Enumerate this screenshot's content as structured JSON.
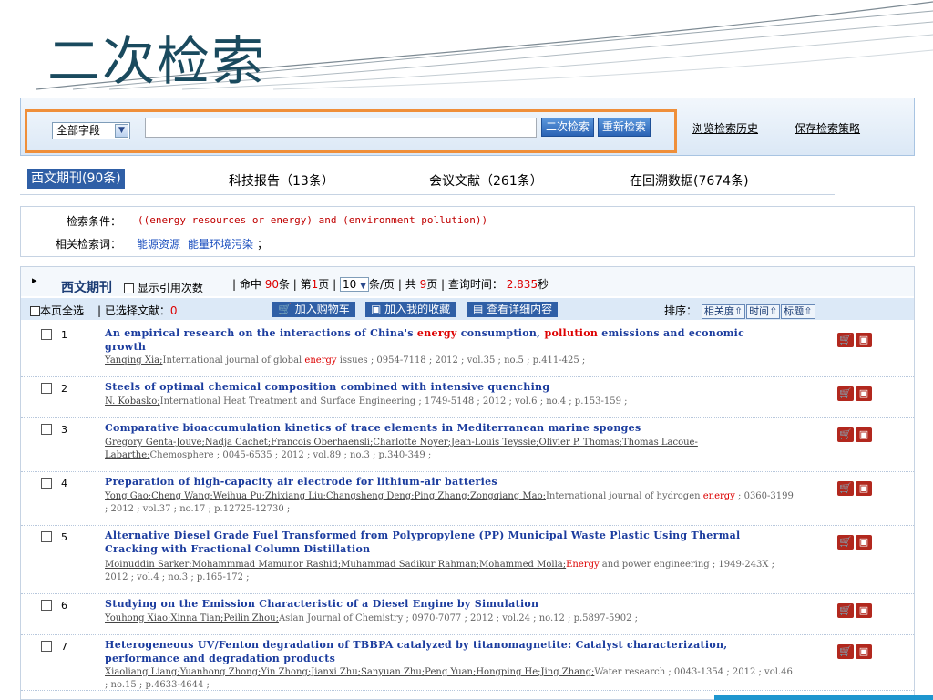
{
  "slide": {
    "title": "二次检索"
  },
  "search": {
    "field_selected": "全部字段",
    "query_value": "",
    "secondary_search_label": "二次检索",
    "new_search_label": "重新检索",
    "history_link": "浏览检索历史",
    "save_strategy_link": "保存检索策略"
  },
  "tabs": [
    {
      "label": "西文期刊(90条)",
      "active": true
    },
    {
      "label": "科技报告（13条）",
      "active": false
    },
    {
      "label": "会议文献（261条）",
      "active": false
    },
    {
      "label": "在回溯数据(7674条)",
      "active": false
    }
  ],
  "conditions": {
    "query_label": "检索条件：",
    "query": "((energy resources or energy) and (environment pollution))",
    "related_label": "相关检索词：",
    "related_terms": [
      "能源资源",
      "能量环境污染"
    ],
    "related_suffix": "；"
  },
  "results_header": {
    "db_name": "西文期刊",
    "show_citations_label": "显示引用次数",
    "hits_prefix": "| 命中",
    "hits": "90",
    "hits_suffix": "条 | 第",
    "page": "1",
    "page_suffix": "页 |",
    "per_page": "10",
    "per_page_suffix": "条/页 | 共",
    "total_pages": "9",
    "total_pages_suffix": "页 | 查询时间：",
    "query_time": "2.835",
    "query_time_suffix": "秒"
  },
  "toolbar": {
    "select_all_label": "本页全选",
    "selected_label": "| 已选择文献：",
    "selected_count": "0",
    "add_cart_label": "加入购物车",
    "add_fav_label": "加入我的收藏",
    "view_detail_label": "查看详细内容",
    "sort_label": "排序：",
    "sort_relevance": "相关度",
    "sort_time": "时间",
    "sort_title": "标题"
  },
  "results": [
    {
      "num": "1",
      "title": [
        "An empirical research on the interactions of China's ",
        {
          "hl": "energy"
        },
        " consumption, ",
        {
          "hl": "pollution"
        },
        " emissions and economic growth"
      ],
      "authors": "Yanqing Xia;",
      "meta": [
        "International journal of global ",
        {
          "hl": "energy"
        },
        " issues ; 0954-7118 ; 2012 ; vol.35 ; no.5 ; p.411-425 ;"
      ]
    },
    {
      "num": "2",
      "title": [
        "Steels of optimal chemical composition combined with intensive quenching"
      ],
      "authors": "N. Kobasko;",
      "meta": [
        "International Heat Treatment and Surface Engineering ; 1749-5148 ; 2012 ; vol.6 ; no.4 ; p.153-159 ;"
      ]
    },
    {
      "num": "3",
      "title": [
        "Comparative bioaccumulation kinetics of trace elements in Mediterranean marine sponges"
      ],
      "authors": "Gregory Genta-Jouve;Nadja Cachet;Francois Oberhaensli;Charlotte Noyer;Jean-Louis Teyssie;Olivier P. Thomas;Thomas Lacoue-Labarthe;",
      "meta": [
        "Chemosphere ; 0045-6535 ; 2012 ; vol.89 ; no.3 ; p.340-349 ;"
      ]
    },
    {
      "num": "4",
      "title": [
        "Preparation of high-capacity air electrode for lithium-air batteries"
      ],
      "authors": "Yong Gao;Cheng Wang;Weihua Pu;Zhixiang Liu;Changsheng Deng;Ping Zhang;Zongqiang Mao;",
      "meta": [
        "International journal of hydrogen ",
        {
          "hl": "energy"
        },
        " ; 0360-3199 ; 2012 ; vol.37 ; no.17 ; p.12725-12730 ;"
      ]
    },
    {
      "num": "5",
      "title": [
        "Alternative Diesel Grade Fuel Transformed from Polypropylene (PP) Municipal Waste Plastic Using Thermal Cracking with Fractional Column Distillation"
      ],
      "authors": "Moinuddin Sarker;Mohammmad Mamunor Rashid;Muhammad Sadikur Rahman;Mohammed Molla;",
      "meta": [
        {
          "hl": "Energy"
        },
        " and power engineering ; 1949-243X ; 2012 ; vol.4 ; no.3 ; p.165-172 ;"
      ]
    },
    {
      "num": "6",
      "title": [
        "Studying on the Emission Characteristic of a Diesel Engine by Simulation"
      ],
      "authors": "Youhong Xiao;Xinna Tian;Peilin Zhou;",
      "meta": [
        "Asian Journal of Chemistry ; 0970-7077 ; 2012 ; vol.24 ; no.12 ; p.5897-5902 ;"
      ]
    },
    {
      "num": "7",
      "title": [
        "Heterogeneous UV/Fenton degradation of TBBPA catalyzed by titanomagnetite: Catalyst characterization, performance and degradation products"
      ],
      "authors": "Xiaoliang Liang;Yuanhong Zhong;Yin Zhong;Jianxi Zhu;Sanyuan Zhu;Peng Yuan;Hongping He;Jing Zhang;",
      "meta": [
        "Water research ; 0043-1354 ; 2012 ; vol.46 ; no.15 ; p.4633-4644 ;"
      ]
    }
  ]
}
